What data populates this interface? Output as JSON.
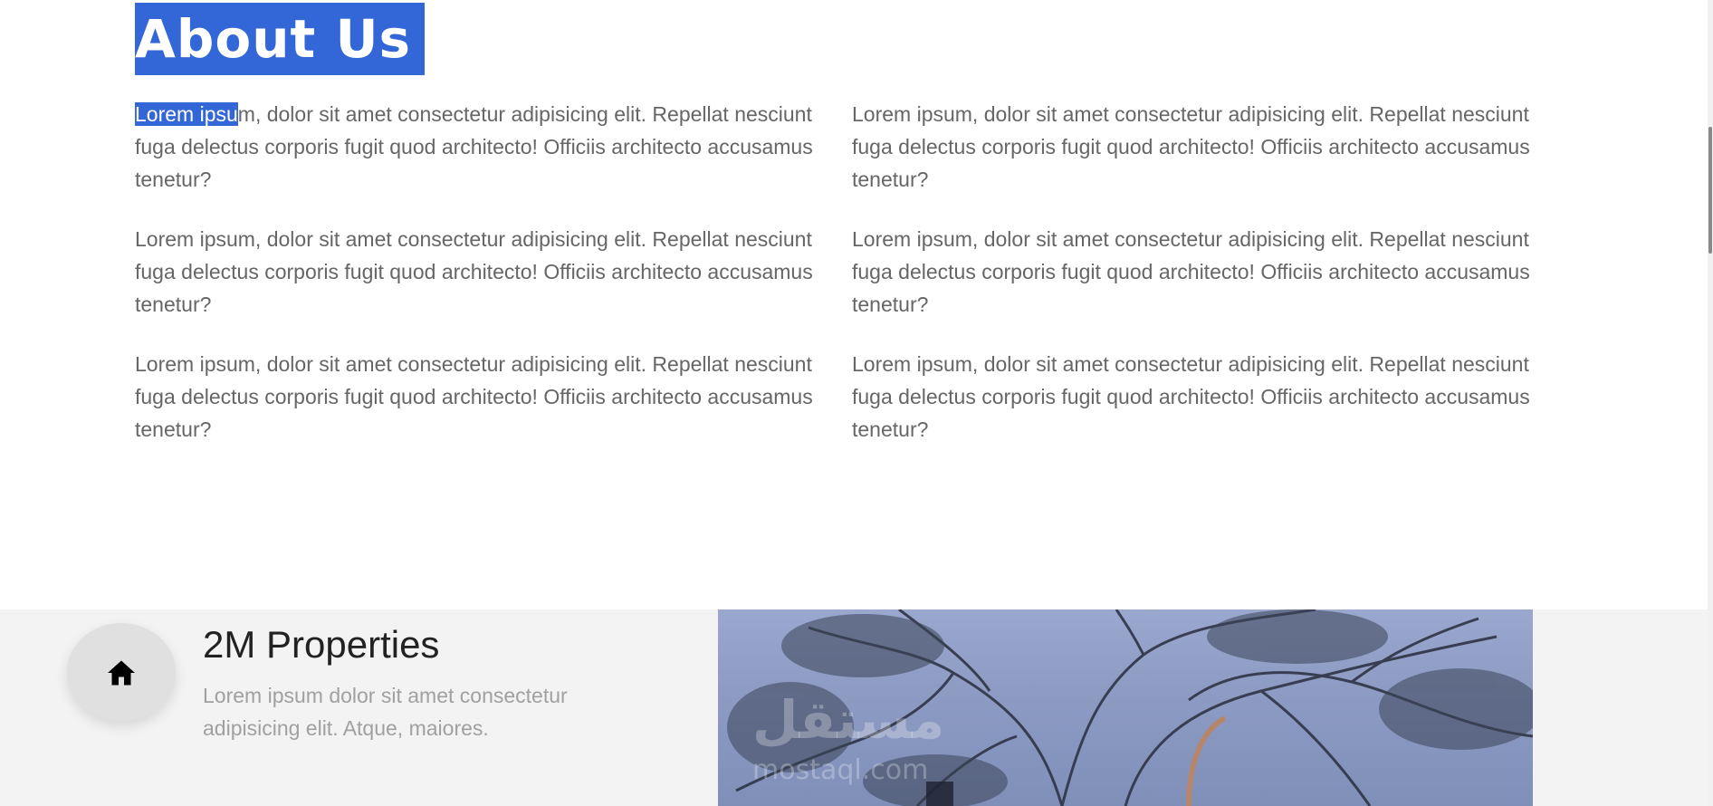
{
  "about": {
    "title": "About Us",
    "paragraph_highlight": "Lorem ipsu",
    "paragraph_rest": "m, dolor sit amet consectetur adipisicing elit. Repellat nesciunt fuga delectus corporis fugit quod architecto! Officiis architecto accusamus tenetur?",
    "paragraphs": [
      "Lorem ipsum, dolor sit amet consectetur adipisicing elit. Repellat nesciunt fuga delectus corporis fugit quod architecto! Officiis architecto accusamus tenetur?",
      "Lorem ipsum, dolor sit amet consectetur adipisicing elit. Repellat nesciunt fuga delectus corporis fugit quod architecto! Officiis architecto accusamus tenetur?",
      "Lorem ipsum, dolor sit amet consectetur adipisicing elit. Repellat nesciunt fuga delectus corporis fugit quod architecto! Officiis architecto accusamus tenetur?",
      "Lorem ipsum, dolor sit amet consectetur adipisicing elit. Repellat nesciunt fuga delectus corporis fugit quod architecto! Officiis architecto accusamus tenetur?",
      "Lorem ipsum, dolor sit amet consectetur adipisicing elit. Repellat nesciunt fuga delectus corporis fugit quod architecto! Officiis architecto accusamus tenetur?",
      "Lorem ipsum, dolor sit amet consectetur adipisicing elit. Repellat nesciunt fuga delectus corporis fugit quod architecto! Officiis architecto accusamus tenetur?"
    ]
  },
  "stats": {
    "icon": "home-icon",
    "title": "2M Properties",
    "description": "Lorem ipsum dolor sit amet consectetur adipisicing elit. Atque, maiores."
  },
  "image": {
    "watermark_ar": "مستقل",
    "watermark_en": "mostaql.com"
  },
  "colors": {
    "accent": "#3366d6",
    "text": "#666666",
    "strip_bg": "#f3f3f3"
  }
}
